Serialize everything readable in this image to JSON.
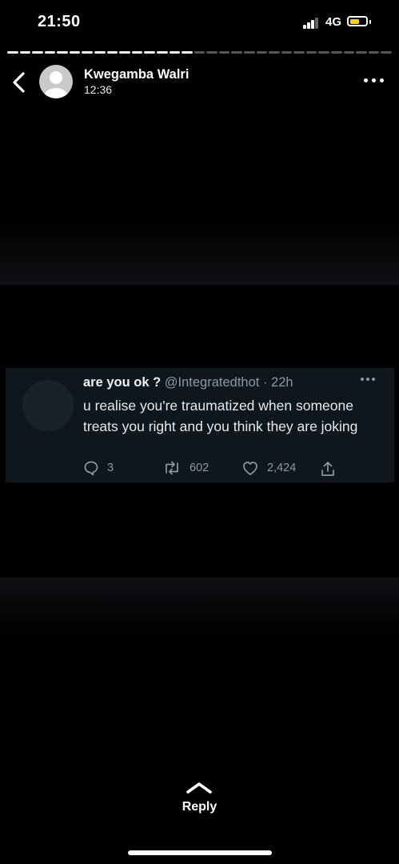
{
  "status_bar": {
    "time": "21:50",
    "network": "4G",
    "battery_level": 0.6,
    "battery_color": "#f7cf1e",
    "signal_icon": "signal-bars-icon"
  },
  "story_progress": {
    "segments_total": 31,
    "segments_viewed": 15
  },
  "header": {
    "contact_name": "Kwegamba Walri",
    "story_time": "12:36",
    "back_icon": "chevron-left-icon",
    "more_icon": "more-dots-icon"
  },
  "tweet": {
    "display_name": "are you ok ?",
    "handle_time": " @Integratedthot · 22h",
    "text": "u realise you're traumatized when someone treats you right and you think they are joking",
    "replies": "3",
    "retweets": "602",
    "likes": "2,424",
    "colors": {
      "card_bg": "#0f171d",
      "muted": "#8b98a5",
      "text": "#e7e9ea"
    }
  },
  "footer": {
    "reply_label": "Reply",
    "reply_icon": "chevron-up-icon"
  }
}
